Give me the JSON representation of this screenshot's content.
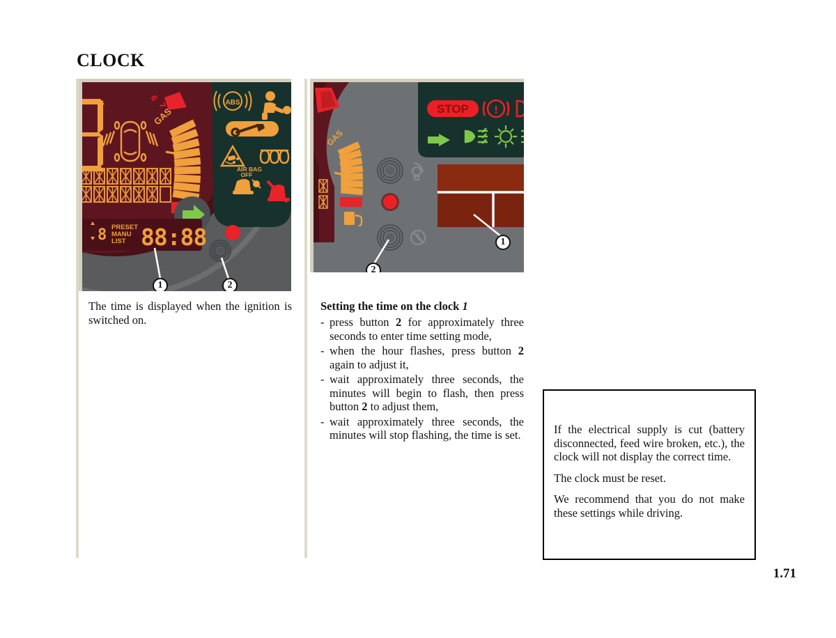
{
  "document": {
    "title": "CLOCK",
    "page_number": "1.71"
  },
  "figures": {
    "left": {
      "caption_callouts": [
        {
          "number": "1",
          "refers_to": "clock-display"
        },
        {
          "number": "2",
          "refers_to": "clock-set-button"
        }
      ],
      "lcd": {
        "clock_value": "88:88",
        "mode_labels": [
          "PRESET",
          "MANU",
          "LIST"
        ],
        "preset_digit": "8",
        "gas_label": "GAS",
        "tach_numbers": [
          "6",
          "7"
        ]
      },
      "warning_icons": [
        "abs-icon",
        "airbag-icon",
        "service-wrench-icon",
        "esp-traction-icon",
        "rear-demist-icon",
        "air-bag-off-icon",
        "seatbelt-icon",
        "turn-signal-right-icon",
        "red-indicator-icon",
        "fuel-pump-icon"
      ]
    },
    "right": {
      "caption_callouts": [
        {
          "number": "1",
          "refers_to": "clock-display"
        },
        {
          "number": "2",
          "refers_to": "clock-set-button"
        }
      ],
      "lcd": {
        "gas_label": "GAS"
      },
      "warning_icons": [
        "stop-icon",
        "brake-warning-icon",
        "turn-signal-left-icon",
        "front-fog-lamp-icon",
        "sidelights-icon",
        "rear-fog-lamp-icon",
        "fuel-pump-icon"
      ],
      "button_icons": [
        "dimmer-bulb-icon",
        "red-reset-button-icon",
        "clock-button-icon"
      ],
      "stop_label": "STOP"
    }
  },
  "left_column": {
    "paragraph": "The time is displayed when the ignition is switched on."
  },
  "right_column": {
    "heading_text": "Setting the time on the clock ",
    "heading_italic": "1",
    "bullets": [
      {
        "marker": "-",
        "segments": [
          {
            "text": "press button ",
            "bold": false
          },
          {
            "text": "2",
            "bold": true
          },
          {
            "text": " for approximately three seconds to enter time setting mode,",
            "bold": false
          }
        ]
      },
      {
        "marker": "-",
        "segments": [
          {
            "text": "when the hour flashes, press button ",
            "bold": false
          },
          {
            "text": "2",
            "bold": true
          },
          {
            "text": " again to adjust it,",
            "bold": false
          }
        ]
      },
      {
        "marker": "-",
        "segments": [
          {
            "text": "wait approximately three seconds, the minutes will begin to flash, then press button ",
            "bold": false
          },
          {
            "text": "2",
            "bold": true
          },
          {
            "text": " to adjust them,",
            "bold": false
          }
        ]
      },
      {
        "marker": "-",
        "segments": [
          {
            "text": "wait approximately three seconds, the minutes will stop flashing, the time is set.",
            "bold": false
          }
        ]
      }
    ]
  },
  "warning_box": {
    "paragraphs": [
      "If the electrical supply is cut (battery disconnected, feed wire broken, etc.), the clock will not display the correct time.",
      "The clock must be reset.",
      "We recommend that you do not make these settings while driving."
    ]
  },
  "colors": {
    "lcd_amber": "#f0a03c",
    "lcd_background_red": "#5d1620",
    "dash_grey": "#595b5c",
    "warn_panel_green": "#17312c",
    "warning_green": "#7ec94a",
    "warning_red": "#ec2024",
    "rule_beige": "#dedacb",
    "figure_frame": "#d4cfbe"
  }
}
